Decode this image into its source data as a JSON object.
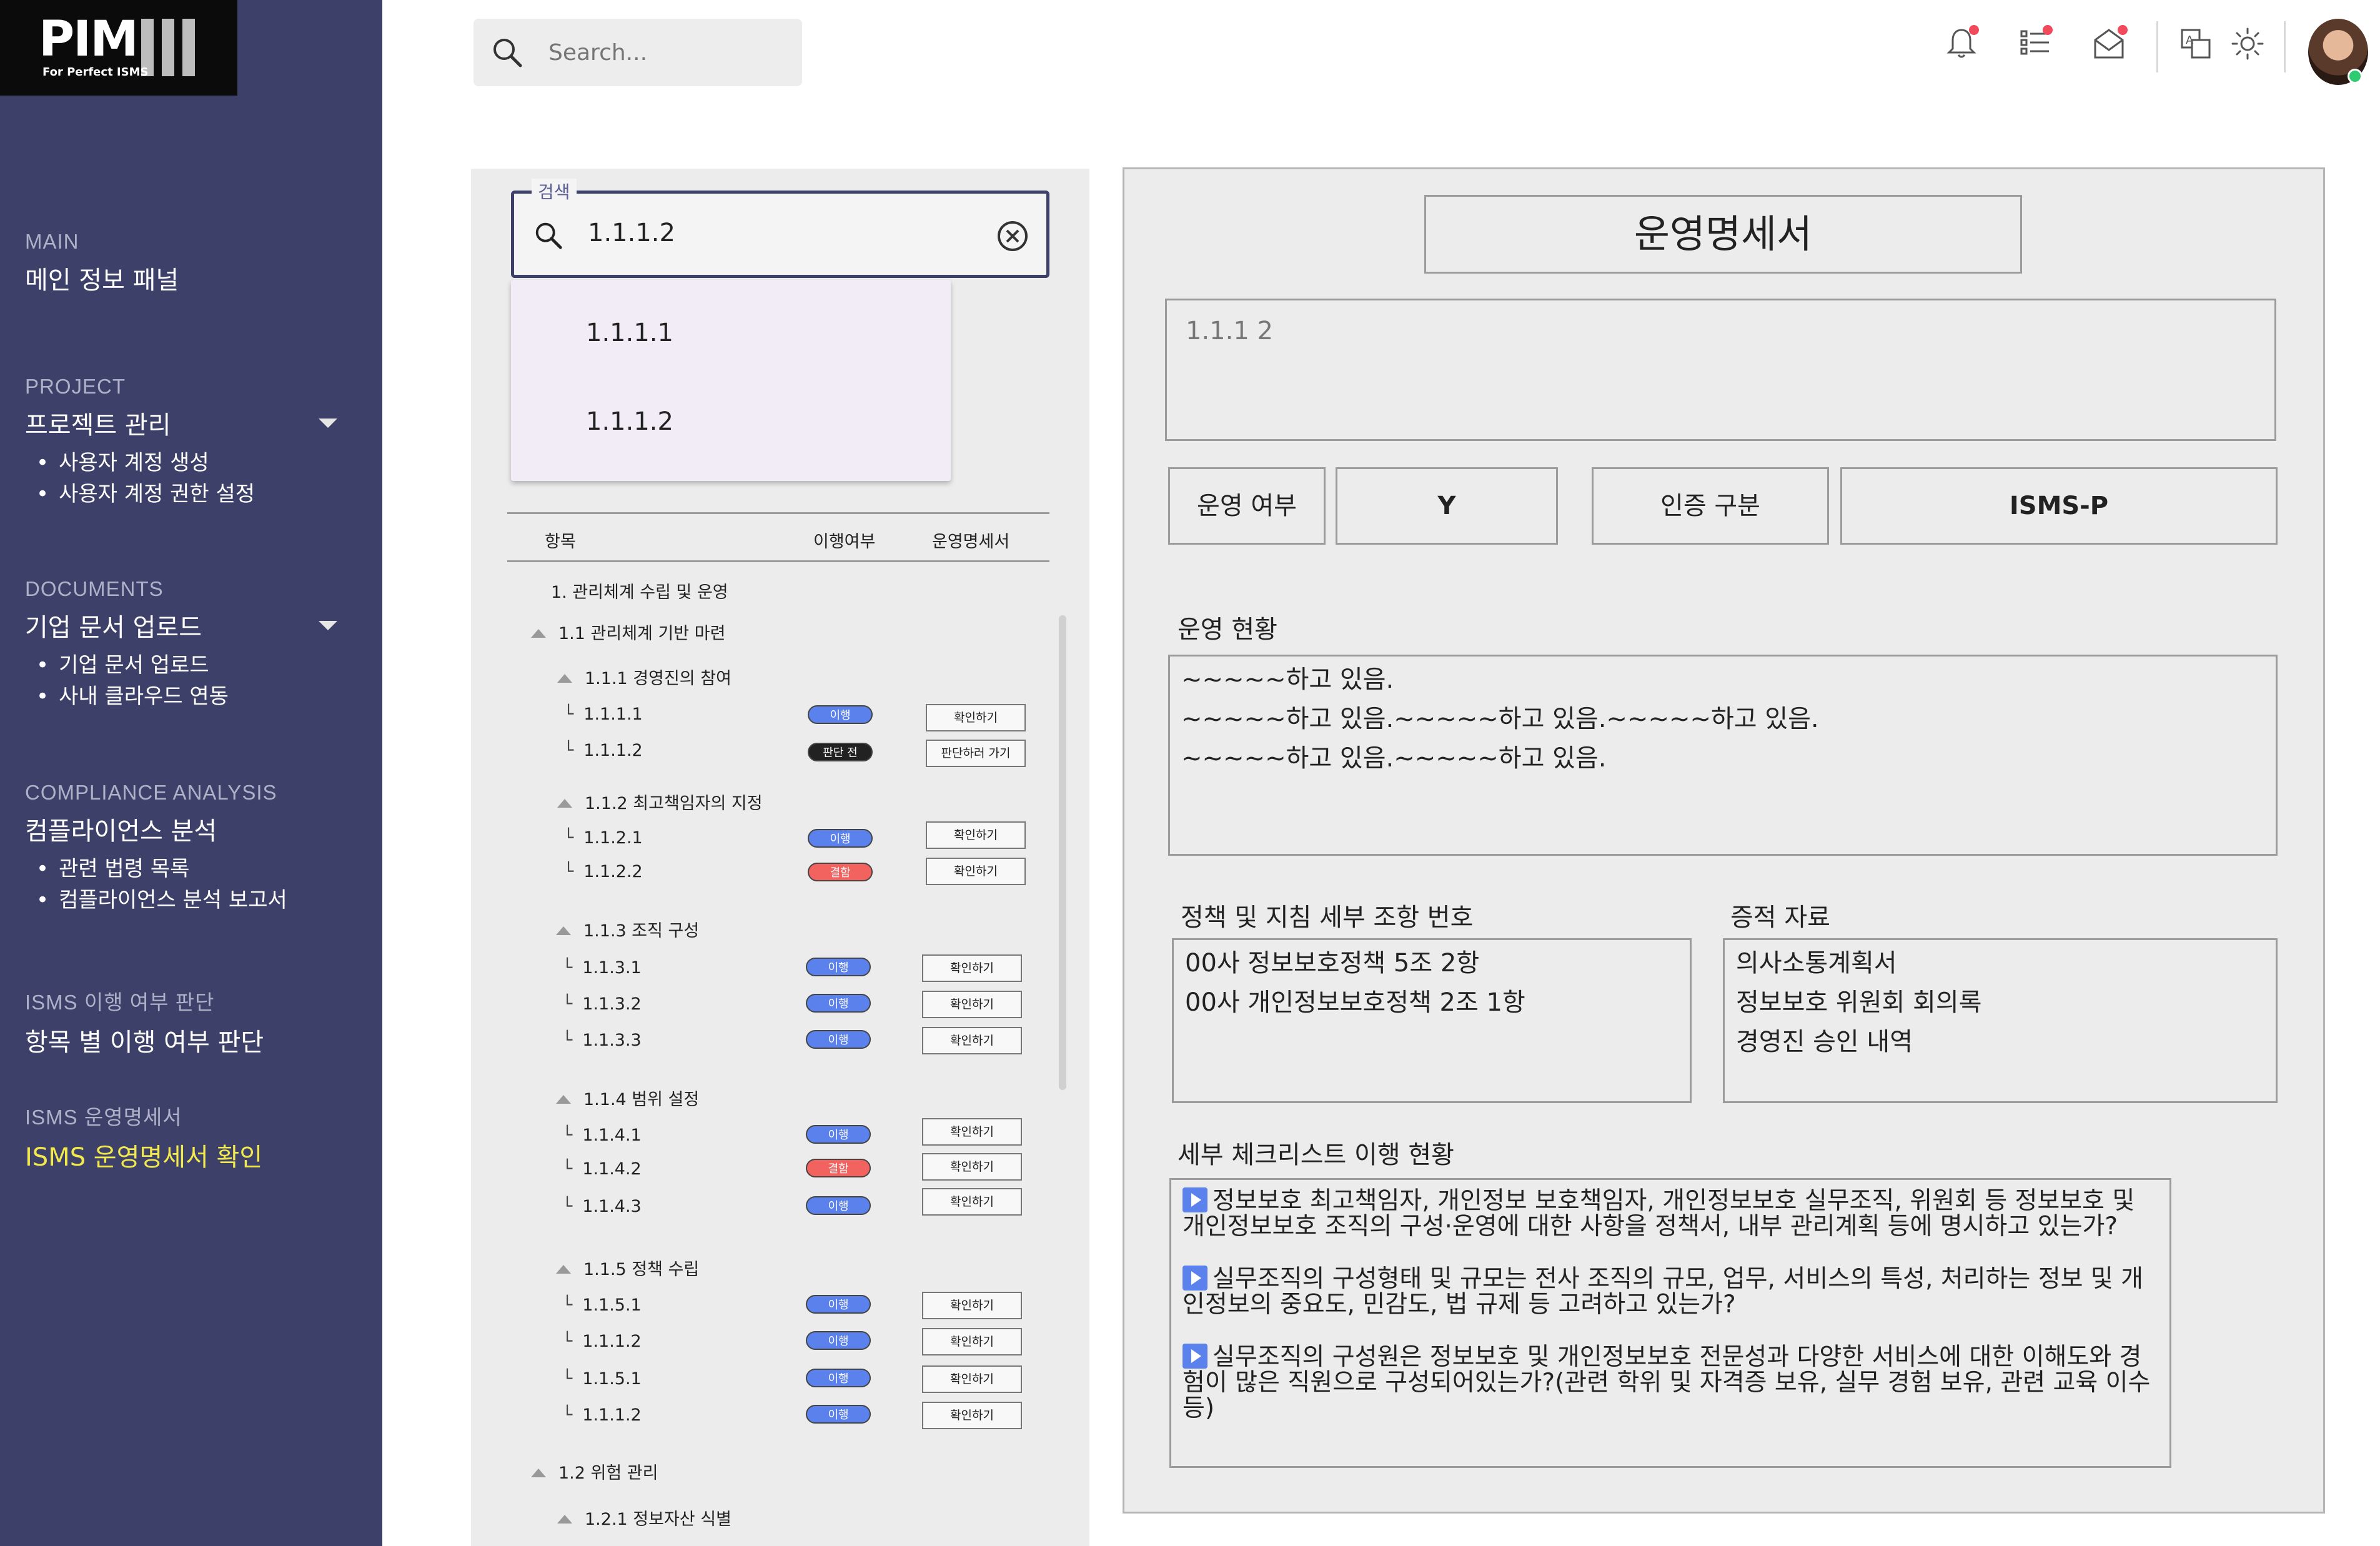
{
  "logo": {
    "word": "PIM",
    "tagline": "For Perfect ISMS"
  },
  "sidebar": {
    "sections": [
      {
        "category": "MAIN",
        "title": "메인 정보 패널",
        "items": []
      },
      {
        "category": "PROJECT",
        "title": "프로젝트 관리",
        "items": [
          "사용자 계정 생성",
          "사용자 계정 권한 설정"
        ]
      },
      {
        "category": "DOCUMENTS",
        "title": "기업 문서 업로드",
        "items": [
          "기업 문서 업로드",
          "사내 클라우드 연동"
        ]
      },
      {
        "category": "COMPLIANCE ANALYSIS",
        "title": "컴플라이언스 분석",
        "items": [
          "관련 법령 목록",
          "컴플라이언스 분석 보고서"
        ]
      },
      {
        "category": "ISMS 이행 여부 판단",
        "title": "항목 별 이행 여부 판단",
        "items": []
      },
      {
        "category": "ISMS 운영명세서",
        "title": "ISMS 운영명세서 확인",
        "items": []
      }
    ],
    "active_color": "#f2e94e",
    "bg_color": "#3d4169"
  },
  "topbar": {
    "search_placeholder": "Search...",
    "icons": [
      "bell-icon",
      "list-icon",
      "mail-icon",
      "translate-icon",
      "sun-icon"
    ]
  },
  "item_search": {
    "legend": "검색",
    "value": "1.1.1.2",
    "suggestions": [
      "1.1.1.1",
      "1.1.1.2"
    ]
  },
  "tree": {
    "headers": {
      "item": "항목",
      "status": "이행여부",
      "doc": "운영명세서"
    },
    "root": "1. 관리체계 수립 및 운영",
    "group_1_1": "1.1 관리체계 기반 마련",
    "sub_1_1_1": "1.1.1 경영진의 참여",
    "sub_1_1_2": "1.1.2 최고책임자의 지정",
    "sub_1_1_3": "1.1.3 조직 구성",
    "sub_1_1_4": "1.1.4 범위 설정",
    "sub_1_1_5": "1.1.5 정책 수립",
    "group_1_2": "1.2 위험 관리",
    "sub_1_2_1": "1.2.1 정보자산 식별",
    "leaves": [
      {
        "id": "1.1.1.1",
        "status": "이행",
        "action": "확인하기"
      },
      {
        "id": "1.1.1.2",
        "status": "판단 전",
        "action": "판단하러 가기"
      },
      {
        "id": "1.1.2.1",
        "status": "이행",
        "action": "확인하기"
      },
      {
        "id": "1.1.2.2",
        "status": "결함",
        "action": "확인하기"
      },
      {
        "id": "1.1.3.1",
        "status": "이행",
        "action": "확인하기"
      },
      {
        "id": "1.1.3.2",
        "status": "이행",
        "action": "확인하기"
      },
      {
        "id": "1.1.3.3",
        "status": "이행",
        "action": "확인하기"
      },
      {
        "id": "1.1.4.1",
        "status": "이행",
        "action": "확인하기"
      },
      {
        "id": "1.1.4.2",
        "status": "결함",
        "action": "확인하기"
      },
      {
        "id": "1.1.4.3",
        "status": "이행",
        "action": "확인하기"
      },
      {
        "id": "1.1.5.1",
        "status": "이행",
        "action": "확인하기"
      },
      {
        "id": "1.1.1.2",
        "status": "이행",
        "action": "확인하기"
      },
      {
        "id": "1.1.5.1",
        "status": "이행",
        "action": "확인하기"
      },
      {
        "id": "1.1.1.2",
        "status": "이행",
        "action": "확인하기"
      }
    ],
    "colors": {
      "yes": "#5b82ec",
      "pending": "#222222",
      "defect": "#f2625f"
    }
  },
  "doc": {
    "title": "운영명세서",
    "item_code": "1.1.1 2",
    "op_label": "운영 여부",
    "op_value": "Y",
    "cert_label": "인증 구분",
    "cert_value": "ISMS-P",
    "status_label": "운영 현황",
    "status_lines": [
      "~~~~~하고 있음.",
      "~~~~~하고 있음.~~~~~하고 있음.~~~~~하고 있음.",
      "~~~~~하고 있음.~~~~~하고 있음."
    ],
    "policy_label": "정책 및 지침 세부 조항 번호",
    "policy_lines": [
      "00사 정보보호정책 5조 2항",
      "00사 개인정보보호정책 2조 1항"
    ],
    "evidence_label": "증적 자료",
    "evidence_lines": [
      "의사소통계획서",
      "정보보호 위원회 회의록",
      "경영진 승인 내역"
    ],
    "checklist_label": "세부 체크리스트 이행 현황",
    "checklist": [
      "정보보호 최고책임자, 개인정보 보호책임자, 개인정보보호 실무조직, 위원회 등 정보보호 및 개인정보보호 조직의 구성·운영에 대한 사항을 정책서, 내부 관리계획 등에 명시하고 있는가?",
      "실무조직의 구성형태 및 규모는 전사 조직의 규모, 업무, 서비스의 특성, 처리하는 정보 및 개인정보의 중요도, 민감도, 법 규제 등 고려하고 있는가?",
      "실무조직의 구성원은 정보보호 및 개인정보보호 전문성과 다양한 서비스에 대한 이해도와 경험이 많은 직원으로 구성되어있는가?(관련 학위 및 자격증 보유, 실무 경험 보유, 관련 교육 이수 등)"
    ]
  }
}
